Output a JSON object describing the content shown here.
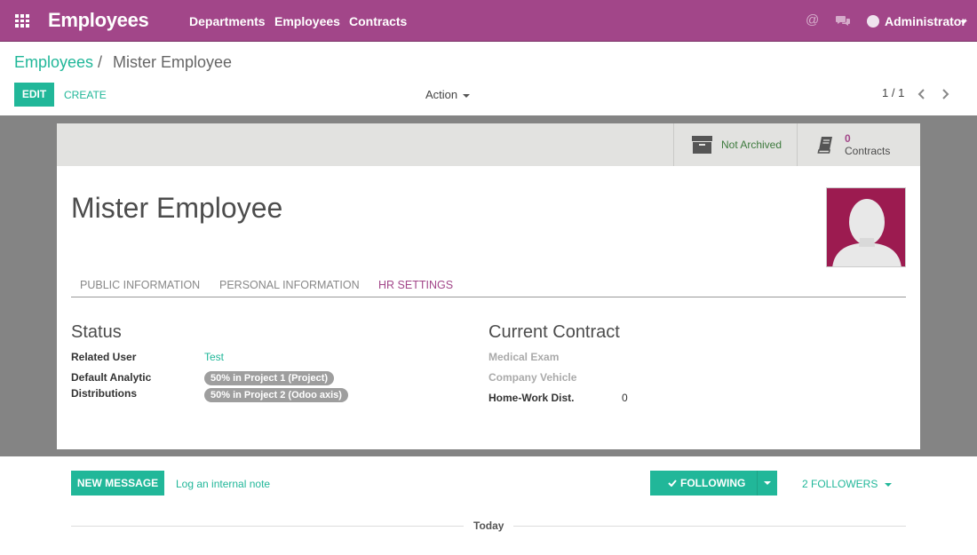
{
  "topbar": {
    "app_title": "Employees",
    "nav": [
      "Departments",
      "Employees",
      "Contracts"
    ],
    "user_name": "Administrator",
    "brand_color": "#a24689"
  },
  "breadcrumb": {
    "parent": "Employees",
    "separator": "/",
    "current": "Mister Employee"
  },
  "control_panel": {
    "edit_label": "EDIT",
    "create_label": "CREATE",
    "action_label": "Action",
    "pager_value": "1 / 1"
  },
  "stat_buttons": {
    "archive_label": "Not Archived",
    "contracts_count": "0",
    "contracts_label": "Contracts"
  },
  "employee": {
    "name": "Mister Employee"
  },
  "tabs": [
    {
      "label": "PUBLIC INFORMATION",
      "active": false
    },
    {
      "label": "PERSONAL INFORMATION",
      "active": false
    },
    {
      "label": "HR SETTINGS",
      "active": true
    }
  ],
  "status": {
    "title": "Status",
    "related_user_label": "Related User",
    "related_user_value": "Test",
    "analytic_label_line1": "Default Analytic",
    "analytic_label_line2": "Distributions",
    "analytic_tags": [
      "50% in Project 1 (Project)",
      "50% in Project 2 (Odoo axis)"
    ]
  },
  "contract": {
    "title": "Current Contract",
    "medical_exam_label": "Medical Exam",
    "company_vehicle_label": "Company Vehicle",
    "home_work_label": "Home-Work Dist.",
    "home_work_value": "0"
  },
  "chatter": {
    "new_message_label": "NEW MESSAGE",
    "log_note_label": "Log an internal note",
    "following_label": "FOLLOWING",
    "followers_label": "2 FOLLOWERS",
    "today_label": "Today"
  },
  "colors": {
    "accent": "#21b799",
    "brand": "#a24689",
    "avatar_bg": "#9c1b50"
  }
}
